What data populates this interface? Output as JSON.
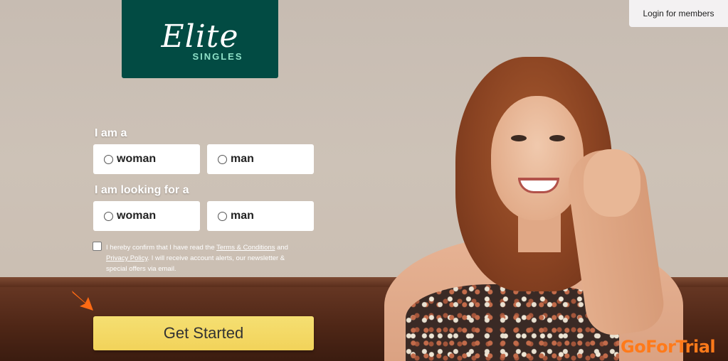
{
  "brand": {
    "logo_text": "Elite",
    "logo_sub": "SINGLES",
    "logo_bg": "#024b43",
    "logo_accent": "#8ee0c7"
  },
  "header": {
    "login_label": "Login for members"
  },
  "form": {
    "i_am_label": "I am a",
    "i_am_options": [
      {
        "label": "woman",
        "selected": false
      },
      {
        "label": "man",
        "selected": false
      }
    ],
    "looking_for_label": "I am looking for a",
    "looking_for_options": [
      {
        "label": "woman",
        "selected": false
      },
      {
        "label": "man",
        "selected": false
      }
    ],
    "consent": {
      "checked": false,
      "text_before": "I hereby confirm that I have read the ",
      "terms_link": "Terms & Conditions",
      "text_and": " and ",
      "privacy_link": "Privacy Policy",
      "text_after": ". I will receive account alerts, our newsletter & special offers via email."
    },
    "cta_label": "Get Started",
    "cta_color": "#f2d35a"
  },
  "overlay": {
    "arrow_icon": "arrow-down-right-icon",
    "arrow_color": "#ff6a13",
    "watermark": "GoForTrial"
  }
}
